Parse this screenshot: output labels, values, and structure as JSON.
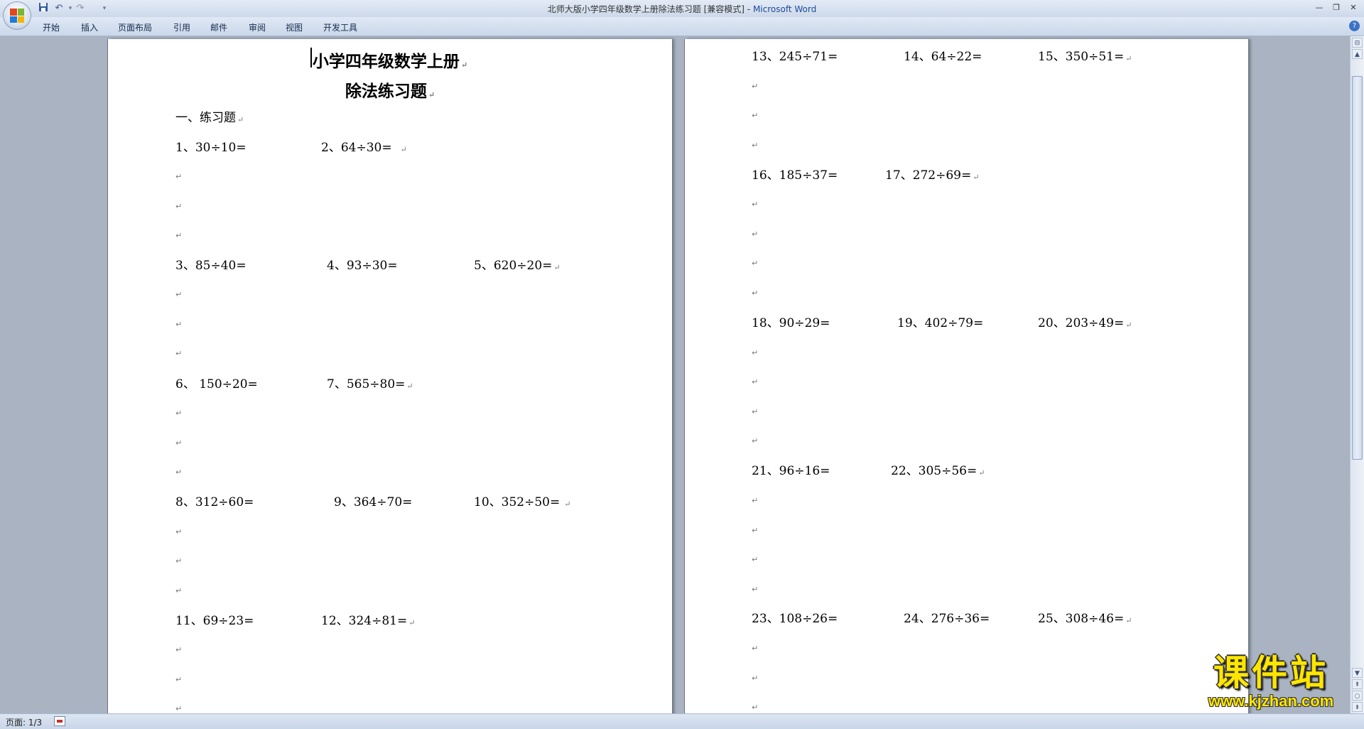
{
  "window": {
    "title_main": "北师大版小学四年级数学上册除法练习题 [兼容模式]",
    "title_sep": " - ",
    "title_app": "Microsoft Word"
  },
  "ribbon": {
    "tabs": [
      "开始",
      "插入",
      "页面布局",
      "引用",
      "邮件",
      "审阅",
      "视图",
      "开发工具"
    ]
  },
  "document": {
    "title1": "小学四年级数学上册",
    "title2": "除法练习题",
    "section": "一、练习题",
    "paragraph_mark": "↵",
    "problems": [
      "1、30÷10=",
      "2、64÷30=",
      "3、85÷40=",
      "4、93÷30=",
      "5、620÷20=",
      "6、 150÷20=",
      "7、565÷80=",
      "8、312÷60=",
      "9、364÷70=",
      "10、352÷50=",
      "11、69÷23=",
      "12、324÷81=",
      "13、245÷71=",
      "14、64÷22=",
      "15、350÷51=",
      "16、185÷37=",
      "17、272÷69=",
      "18、90÷29=",
      "19、402÷79=",
      "20、203÷49=",
      "21、96÷16=",
      "22、305÷56=",
      "23、108÷26=",
      "24、276÷36=",
      "25、308÷46="
    ]
  },
  "status": {
    "page": "页面: 1/3"
  },
  "watermark": {
    "cn": "课件站",
    "url": "www.kjzhan.com"
  },
  "colors": {
    "accent": "#1f4b9c",
    "workspace": "#a9b3c2",
    "watermark": "#ffe600"
  },
  "icons": {
    "office": "office-logo-icon",
    "save": "save-icon",
    "undo": "undo-icon",
    "redo": "redo-icon",
    "help": "help-icon"
  }
}
